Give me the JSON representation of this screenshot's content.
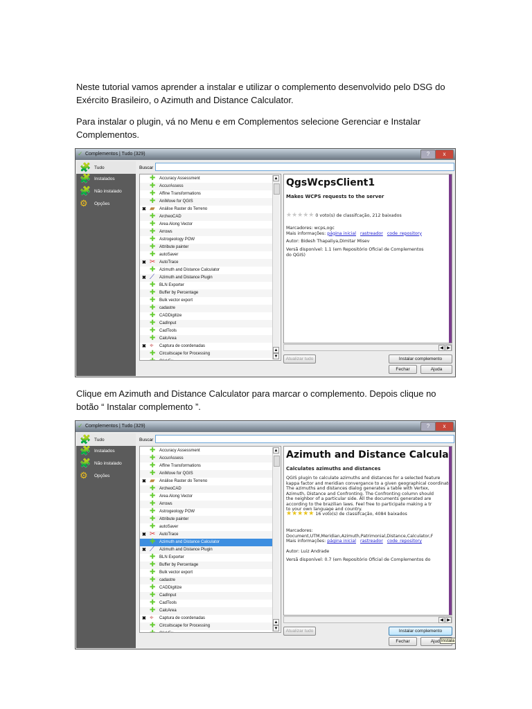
{
  "paragraphs": [
    "Neste tutorial vamos aprender a instalar e utilizar o complemento desenvolvido pelo DSG do Exército Brasileiro, o Azimuth and Distance Calculator.",
    "Para instalar o plugin, vá no Menu e em Complementos  selecione Gerenciar e Instalar Complementos.",
    "Clique em Azimuth and Distance Calculator para marcar o complemento. Depois clique no botão “ Instalar complemento ”."
  ],
  "dialog": {
    "title": "Complementos | Tudo (329)",
    "help_btn": "?",
    "close_btn": "x",
    "sidebar": [
      {
        "label": "Tudo",
        "icon": "puzzle-all-icon"
      },
      {
        "label": "Instalados",
        "icon": "puzzle-installed-icon"
      },
      {
        "label": "Não instalado",
        "icon": "puzzle-not-installed-icon"
      },
      {
        "label": "Opções",
        "icon": "gear-icon"
      }
    ],
    "search_label": "Buscar",
    "search_value": "",
    "plugins": [
      {
        "name": "Accuracy Assessment",
        "mark": ""
      },
      {
        "name": "AccurAssess",
        "mark": ""
      },
      {
        "name": "Affine Transformations",
        "mark": ""
      },
      {
        "name": "AniMove for QGIS",
        "mark": ""
      },
      {
        "name": "Análise Raster do Terreno",
        "mark": "✖"
      },
      {
        "name": "ArcheoCAD",
        "mark": ""
      },
      {
        "name": "Area Along Vector",
        "mark": ""
      },
      {
        "name": "Arrows",
        "mark": ""
      },
      {
        "name": "Astrogeology POW",
        "mark": ""
      },
      {
        "name": "Attribute painter",
        "mark": ""
      },
      {
        "name": "autoSaver",
        "mark": ""
      },
      {
        "name": "AutoTrace",
        "mark": "✖"
      },
      {
        "name": "Azimuth and Distance Calculator",
        "mark": ""
      },
      {
        "name": "Azimuth and Distance Plugin",
        "mark": "✖"
      },
      {
        "name": "BLN Exporter",
        "mark": ""
      },
      {
        "name": "Buffer by Percentage",
        "mark": ""
      },
      {
        "name": "Bulk vector export",
        "mark": ""
      },
      {
        "name": "cadastre",
        "mark": ""
      },
      {
        "name": "CADDigitize",
        "mark": ""
      },
      {
        "name": "CadInput",
        "mark": ""
      },
      {
        "name": "CadTools",
        "mark": ""
      },
      {
        "name": "CalcArea",
        "mark": ""
      },
      {
        "name": "Captura de coordenadas",
        "mark": "✖"
      },
      {
        "name": "Circuitscape for Processing",
        "mark": ""
      },
      {
        "name": "ClickFu",
        "mark": ""
      }
    ],
    "btn_update_all": "Atualizar tudo",
    "btn_install": "Instalar complemento",
    "btn_close": "Fechar",
    "btn_help": "Ajuda"
  },
  "shot1": {
    "selected": -1,
    "name": "QgsWcpsClient1",
    "summary": "Makes WCPS requests to the server",
    "description": "",
    "stars": "★★★★★",
    "star_color": "#c8c8c8",
    "rating": "0 voto(s) de classifcação, 212 baixados",
    "tags": "Marcadores: wcps,ogc",
    "more_label": "Mais informações:",
    "links": [
      "página inicial",
      "rastreador",
      "code_repository"
    ],
    "author": "Autor: Bidesh Thapaliya,Dimitar Misev",
    "version": "Versã disponível: 1.1 (em Repositório Oficial de Complementos\ndo QGIS)"
  },
  "shot2": {
    "selected": 12,
    "name": "Azimuth and Distance Calculator",
    "summary": "Calculates azimuths and distances",
    "description": "QGIS plugin to calculate azimuths and distances for a selected feature\nkappa factor and meridian convergance to a given geographical coordinate\nThe azimuths and distances dialog generates a table with Vertex,\nAzimuth, Distance and Confronting. The Confronting column should\nthe neighbor of a particular side. All the documents generated are\naccording to the brazilian laws. Feel free to participate making a tr\nto your own language and country.",
    "stars": "★★★★★",
    "star_color": "#e8c21a",
    "rating": "16 voto(s) de classifcação, 4084 baixados",
    "tags": "Marcadores:\nDocument,UTM,Meridian,Azimuth,Patrimonial,Distance,Calculator,F",
    "more_label": "Mais informações:",
    "links": [
      "página inicial",
      "rastreador",
      "code_repository"
    ],
    "author": "Autor: Luiz Andrade",
    "version": "Versã disponível: 0.7 (em Repositório Oficial de Complementos do",
    "tooltip": "Instala"
  }
}
